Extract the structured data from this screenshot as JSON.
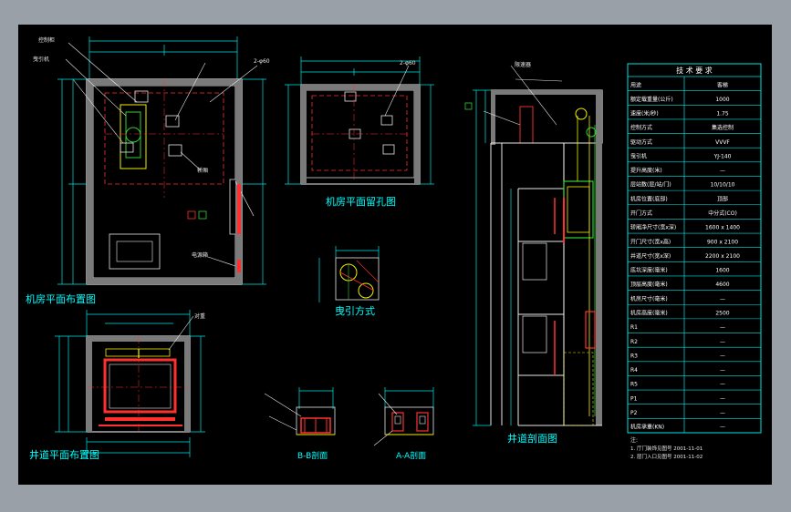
{
  "titles": {
    "machine_room_layout": "机房平面布置图",
    "machine_room_holes": "机房平面留孔图",
    "traction_method": "曳引方式",
    "hoistway_layout": "井道平面布置图",
    "hoistway_section": "井道剖面图",
    "section_b": "B-B剖面",
    "section_a": "A-A剖面"
  },
  "callouts": {
    "a1": "控制柜",
    "a2": "曳引机",
    "a3": "2-φ60",
    "a4": "2-φ60",
    "a5": "轿厢",
    "a6": "对重",
    "a7": "限速器",
    "a8": "电源箱"
  },
  "spec_table": {
    "header": "技 术 要 求",
    "rows": [
      {
        "label": "用途",
        "value": "客梯"
      },
      {
        "label": "额定载重量(公斤)",
        "value": "1000"
      },
      {
        "label": "速度(米/秒)",
        "value": "1.75"
      },
      {
        "label": "控制方式",
        "value": "集选控制"
      },
      {
        "label": "驱动方式",
        "value": "VVVF"
      },
      {
        "label": "曳引机",
        "value": "YJ-140"
      },
      {
        "label": "提升高度(米)",
        "value": "—"
      },
      {
        "label": "层站数(层/站/门)",
        "value": "10/10/10"
      },
      {
        "label": "机房位置(底部)",
        "value": "顶部"
      },
      {
        "label": "开门方式",
        "value": "中分式(CO)"
      },
      {
        "label": "轿厢净尺寸(宽x深)",
        "value": "1600 x 1400"
      },
      {
        "label": "开门尺寸(宽x高)",
        "value": "900 x 2100"
      },
      {
        "label": "井道尺寸(宽x深)",
        "value": "2200 x 2100"
      },
      {
        "label": "底坑深度(毫米)",
        "value": "1600"
      },
      {
        "label": "顶层高度(毫米)",
        "value": "4600"
      },
      {
        "label": "机房尺寸(毫米)",
        "value": "—"
      },
      {
        "label": "机房高度(毫米)",
        "value": "2500"
      },
      {
        "label": "R1",
        "value": "—"
      },
      {
        "label": "R2",
        "value": "—"
      },
      {
        "label": "R3",
        "value": "—"
      },
      {
        "label": "R4",
        "value": "—"
      },
      {
        "label": "R5",
        "value": "—"
      },
      {
        "label": "P1",
        "value": "—"
      },
      {
        "label": "P2",
        "value": "—"
      },
      {
        "label": "机房承重(KN)",
        "value": "—"
      }
    ],
    "notes_header": "注:",
    "notes": [
      "1. 厅门装饰见图号 2001-11-01",
      "2. 层门入口见图号 2001-11-02"
    ]
  },
  "colors": {
    "outline": "#e8e8e8",
    "dimension": "#00e5e5",
    "hidden": "#ff3030",
    "green": "#30d030",
    "yellow": "#f0f000",
    "title": "#00ffff"
  }
}
